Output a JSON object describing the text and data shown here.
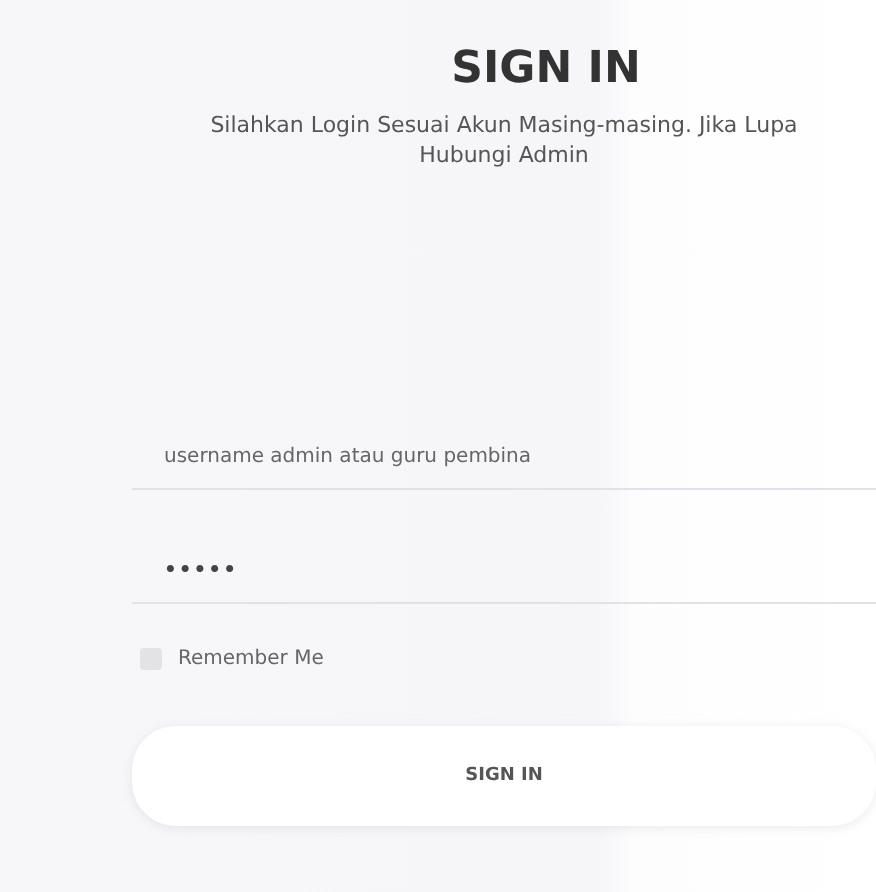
{
  "title": "SIGN IN",
  "subtitle": "Silahkan Login Sesuai Akun Masing-masing. Jika Lupa Hubungi Admin",
  "fields": [
    {
      "kind": "text",
      "placeholder": "username admin atau guru pembina"
    },
    {
      "kind": "password",
      "value": "•••••"
    }
  ],
  "remember": {
    "label": "Remember Me",
    "checked": false
  },
  "button": "SIGN IN"
}
